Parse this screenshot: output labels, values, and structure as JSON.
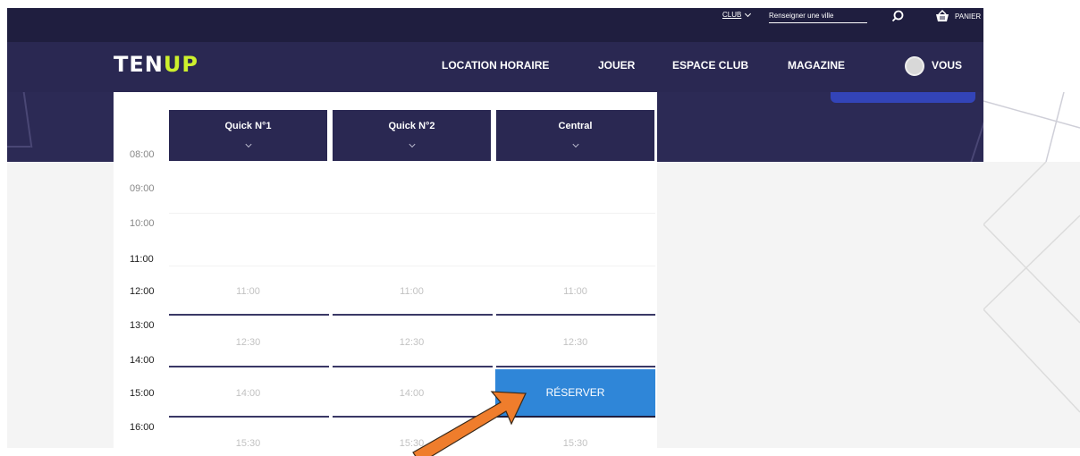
{
  "topbar": {
    "club_label": "CLUB",
    "city_placeholder": "Renseigner une ville",
    "cart_label": "PANIER"
  },
  "navbar": {
    "logo_a": "TEN",
    "logo_b": "UP",
    "items": [
      "LOCATION HORAIRE",
      "JOUER",
      "ESPACE CLUB",
      "MAGAZINE",
      "VOUS"
    ]
  },
  "schedule": {
    "hours": [
      "08:00",
      "09:00",
      "10:00",
      "11:00",
      "12:00",
      "13:00",
      "14:00",
      "15:00",
      "16:00"
    ],
    "courts": [
      {
        "name": "Quick N°1"
      },
      {
        "name": "Quick N°2"
      },
      {
        "name": "Central"
      }
    ],
    "slot_times": [
      "11:00",
      "12:30",
      "14:00",
      "15:30"
    ],
    "reserve_label": "RÉSERVER"
  },
  "colors": {
    "navy": "#2a2852",
    "accent_lime": "#cdf02d",
    "reserve_blue": "#2f86d8",
    "annotation_orange": "#ef7d2c"
  }
}
